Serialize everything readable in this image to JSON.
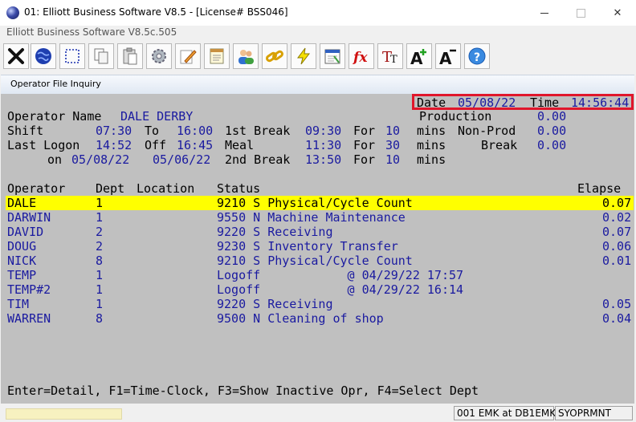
{
  "window": {
    "title": "01: Elliott Business Software V8.5 - [License# BSS046]",
    "subtitle": "Elliott Business Software V8.5c.505",
    "minimize": "—",
    "maximize": "☐",
    "close": "✕"
  },
  "toolbar": {
    "buttons": [
      {
        "name": "exit-icon"
      },
      {
        "name": "globe-icon"
      },
      {
        "name": "select-icon"
      },
      {
        "name": "copy-icon"
      },
      {
        "name": "paste-icon"
      },
      {
        "name": "settings-gear-icon"
      },
      {
        "name": "edit-pencil-icon"
      },
      {
        "name": "notepad-icon"
      },
      {
        "name": "users-icon"
      },
      {
        "name": "link-chain-icon"
      },
      {
        "name": "lightning-icon"
      },
      {
        "name": "calendar-icon"
      },
      {
        "name": "function-fx-icon"
      },
      {
        "name": "text-size-icon"
      },
      {
        "name": "font-increase-icon"
      },
      {
        "name": "font-decrease-icon"
      },
      {
        "name": "help-icon"
      }
    ]
  },
  "inner": {
    "title": "Operator File Inquiry"
  },
  "header": {
    "date_label": "Date",
    "date": "05/08/22",
    "time_label": "Time",
    "time": "14:56:44",
    "operator_name_label": "Operator Name",
    "operator_name": "DALE DERBY",
    "production_label": "Production",
    "production": "0.00",
    "shift_label": "Shift",
    "shift_start": "07:30",
    "to_label": "To",
    "shift_end": "16:00",
    "break1_label": "1st Break",
    "break1_time": "09:30",
    "for_label": "For",
    "break1_mins": "10",
    "mins_label": "mins",
    "nonprod_label": "Non-Prod",
    "nonprod": "0.00",
    "last_logon_label": "Last Logon",
    "last_logon_time": "14:52",
    "off_label": "Off",
    "off_time": "16:45",
    "meal_label": "Meal",
    "meal_time": "11:30",
    "meal_mins": "30",
    "break_label": "Break",
    "break_value": "0.00",
    "on_label": "on",
    "logon_date": "05/08/22",
    "off_date": "05/06/22",
    "break2_label": "2nd Break",
    "break2_time": "13:50",
    "break2_mins": "10"
  },
  "table": {
    "columns": {
      "operator": "Operator",
      "dept": "Dept",
      "location": "Location",
      "status": "Status",
      "elapse": "Elapse"
    },
    "rows": [
      {
        "operator": "DALE",
        "dept": "1",
        "status": "9210 S Physical/Cycle Count",
        "elapse": "0.07",
        "highlighted": true
      },
      {
        "operator": "DARWIN",
        "dept": "1",
        "status": "9550 N Machine Maintenance",
        "elapse": "0.02"
      },
      {
        "operator": "DAVID",
        "dept": "2",
        "status": "9220 S Receiving",
        "elapse": "0.07"
      },
      {
        "operator": "DOUG",
        "dept": "2",
        "status": "9230 S Inventory Transfer",
        "elapse": "0.06"
      },
      {
        "operator": "NICK",
        "dept": "8",
        "status": "9210 S Physical/Cycle Count",
        "elapse": "0.01"
      },
      {
        "operator": "TEMP",
        "dept": "1",
        "status": "Logoff            @ 04/29/22 17:57",
        "elapse": ""
      },
      {
        "operator": "TEMP#2",
        "dept": "1",
        "status": "Logoff            @ 04/29/22 16:14",
        "elapse": ""
      },
      {
        "operator": "TIM",
        "dept": "1",
        "status": "9220 S Receiving",
        "elapse": "0.05"
      },
      {
        "operator": "WARREN",
        "dept": "8",
        "status": "9500 N Cleaning of shop",
        "elapse": "0.04"
      }
    ]
  },
  "footer": {
    "keys": "Enter=Detail, F1=Time-Clock, F3=Show Inactive Opr, F4=Select Dept"
  },
  "statusbar": {
    "connection": "001 EMK at DB1EMK",
    "program": "SYOPRMNT"
  },
  "colors": {
    "terminal_bg": "#c0c0c0",
    "value_text": "#1a1aa0",
    "highlight": "#ffff00",
    "annotation_box": "#e0162b"
  }
}
